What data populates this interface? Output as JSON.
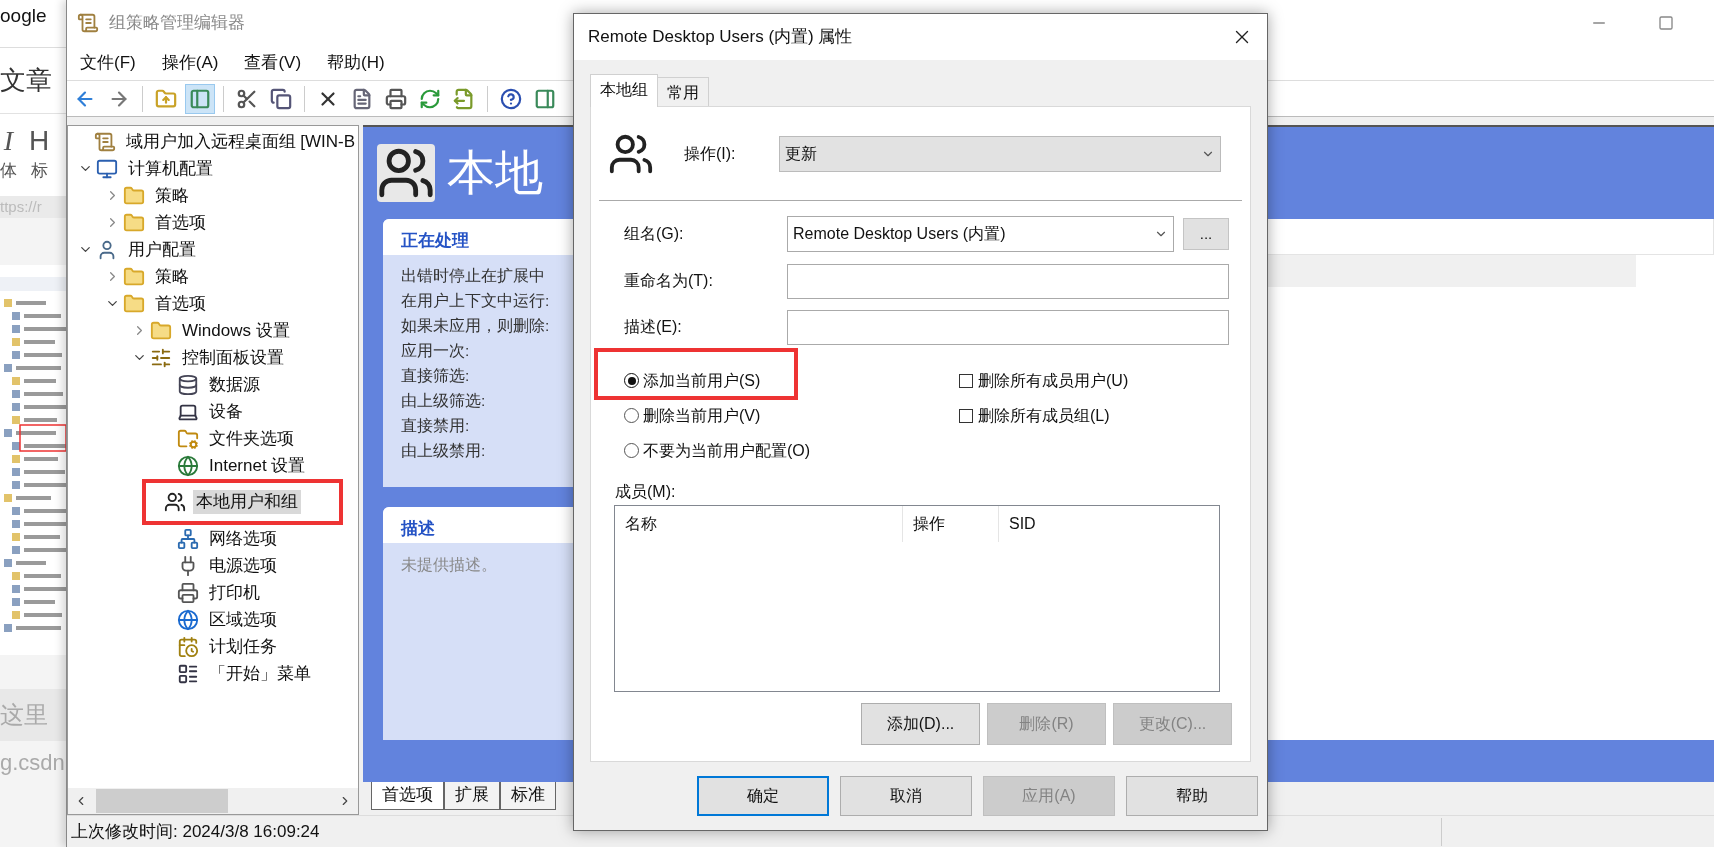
{
  "background_page": {
    "tab_title": "oogle",
    "heading": "文章",
    "format_buttons": [
      {
        "glyph": "I",
        "label": "体"
      },
      {
        "glyph": "H",
        "label": "标"
      }
    ],
    "url": "ttps://r",
    "placeholder": "这里",
    "link": "g.csdn"
  },
  "window": {
    "title": "组策略管理编辑器"
  },
  "menu": [
    "文件(F)",
    "操作(A)",
    "查看(V)",
    "帮助(H)"
  ],
  "toolbar_buttons": [
    {
      "selected": false
    },
    {
      "selected": false
    },
    {
      "selected": false
    },
    {
      "selected": true
    },
    {
      "selected": false
    },
    {
      "selected": false
    },
    {
      "selected": false
    },
    {
      "selected": false
    },
    {
      "selected": false
    },
    {
      "selected": false
    },
    {
      "selected": false
    },
    {
      "selected": false
    },
    {
      "selected": false
    }
  ],
  "tree": [
    {
      "label": "域用户加入远程桌面组 [WIN-B",
      "kind": "root",
      "selected": false,
      "children": [
        {
          "label": "计算机配置",
          "kind": "computer",
          "selected": false,
          "expanded": true,
          "children": [
            {
              "label": "策略",
              "kind": "folder",
              "selected": false,
              "expanded": false
            },
            {
              "label": "首选项",
              "kind": "folder",
              "selected": false,
              "expanded": false
            }
          ]
        },
        {
          "label": "用户配置",
          "kind": "user",
          "selected": false,
          "expanded": true,
          "children": [
            {
              "label": "策略",
              "kind": "folder",
              "selected": false,
              "expanded": false
            },
            {
              "label": "首选项",
              "kind": "folder",
              "selected": false,
              "expanded": true,
              "children": [
                {
                  "label": "Windows 设置",
                  "kind": "folder",
                  "selected": false,
                  "expanded": false
                },
                {
                  "label": "控制面板设置",
                  "kind": "panel",
                  "selected": false,
                  "expanded": true,
                  "children": [
                    {
                      "label": "数据源",
                      "kind": "datasource",
                      "selected": false
                    },
                    {
                      "label": "设备",
                      "kind": "device",
                      "selected": false
                    },
                    {
                      "label": "文件夹选项",
                      "kind": "folderoptions",
                      "selected": false
                    },
                    {
                      "label": "Internet 设置",
                      "kind": "internet",
                      "selected": false
                    },
                    {
                      "label": "本地用户和组",
                      "kind": "localusers",
                      "selected": true
                    },
                    {
                      "label": "网络选项",
                      "kind": "network",
                      "selected": false
                    },
                    {
                      "label": "电源选项",
                      "kind": "power",
                      "selected": false
                    },
                    {
                      "label": "打印机",
                      "kind": "printer",
                      "selected": false
                    },
                    {
                      "label": "区域选项",
                      "kind": "regional",
                      "selected": false
                    },
                    {
                      "label": "计划任务",
                      "kind": "tasks",
                      "selected": false
                    },
                    {
                      "label": "「开始」菜单",
                      "kind": "startmenu",
                      "selected": false
                    }
                  ]
                }
              ]
            }
          ]
        }
      ]
    }
  ],
  "pane": {
    "title": "本地",
    "processing": {
      "title": "正在处理",
      "lines": [
        "出错时停止在扩展中",
        "在用户上下文中运行:",
        "如果未应用，则删除:",
        "应用一次:",
        "直接筛选:",
        "由上级筛选:",
        "直接禁用:",
        "由上级禁用:"
      ]
    },
    "description": {
      "title": "描述",
      "text": "未提供描述。"
    },
    "tabs": [
      {
        "label": "首选项",
        "selected": true
      },
      {
        "label": "扩展",
        "selected": false
      },
      {
        "label": "标准",
        "selected": false
      }
    ]
  },
  "status_bar": "上次修改时间: 2024/3/8 16:09:24",
  "dialog": {
    "title": "Remote Desktop Users (内置) 属性",
    "tabs": [
      {
        "label": "本地组",
        "selected": true
      },
      {
        "label": "常用",
        "selected": false
      }
    ],
    "operation": {
      "label": "操作(I):",
      "value": "更新"
    },
    "group_name": {
      "label": "组名(G):",
      "value": "Remote Desktop Users (内置)",
      "button": "..."
    },
    "rename": {
      "label": "重命名为(T):"
    },
    "description": {
      "label": "描述(E):"
    },
    "radios": [
      {
        "label": "添加当前用户(S)",
        "selected": true
      },
      {
        "label": "删除当前用户(V)",
        "selected": false
      },
      {
        "label": "不要为当前用户配置(O)",
        "selected": false
      }
    ],
    "checkboxes": [
      {
        "label": "删除所有成员用户(U)",
        "checked": false
      },
      {
        "label": "删除所有成员组(L)",
        "checked": false
      }
    ],
    "members": {
      "label": "成员(M):",
      "columns": [
        "名称",
        "操作",
        "SID"
      ]
    },
    "member_buttons": [
      {
        "label": "添加(D)...",
        "disabled": false
      },
      {
        "label": "删除(R)",
        "disabled": true
      },
      {
        "label": "更改(C)...",
        "disabled": true
      }
    ],
    "buttons": [
      {
        "label": "确定",
        "disabled": false,
        "default": true
      },
      {
        "label": "取消",
        "disabled": false,
        "default": false
      },
      {
        "label": "应用(A)",
        "disabled": true,
        "default": false
      },
      {
        "label": "帮助",
        "disabled": false,
        "default": false
      }
    ]
  }
}
